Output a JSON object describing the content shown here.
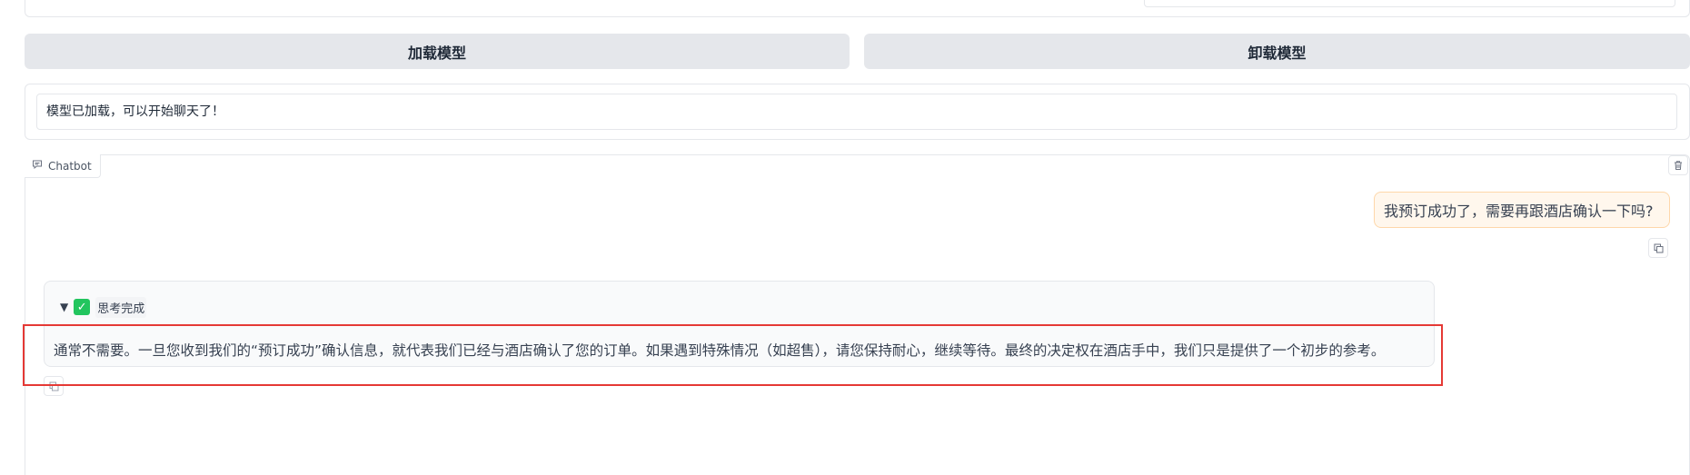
{
  "buttons": {
    "load_label": "加载模型",
    "unload_label": "卸载模型"
  },
  "status": {
    "text": "模型已加载，可以开始聊天了！"
  },
  "chatbot": {
    "label": "Chatbot",
    "messages": [
      {
        "role": "user",
        "text": "我预订成功了，需要再跟酒店确认一下吗?"
      },
      {
        "role": "assistant",
        "thinking_label": "思考完成",
        "thinking_arrow": "▼",
        "check_glyph": "✓",
        "text": "通常不需要。一旦您收到我们的“预订成功”确认信息，就代表我们已经与酒店确认了您的订单。如果遇到特殊情况（如超售），请您保持耐心，继续等待。最终的决定权在酒店手中，我们只是提供了一个初步的参考。"
      }
    ]
  },
  "icons": {
    "chat": "chat-bubble-icon",
    "trash": "trash-icon",
    "copy": "copy-icon",
    "check": "checkmark-icon"
  },
  "colors": {
    "user_bubble_bg": "#fff7ed",
    "highlight_border": "#e53935",
    "button_bg": "#e5e7eb",
    "check_green": "#22c55e"
  }
}
